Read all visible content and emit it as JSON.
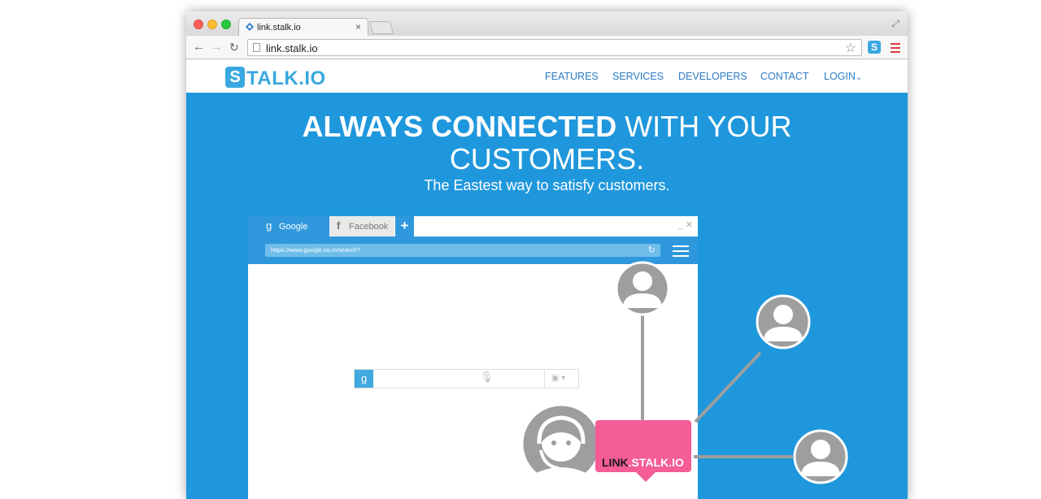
{
  "browser": {
    "tab_title": "link.stalk.io",
    "tab_close": "×",
    "url": "link.stalk.io",
    "extension_letter": "S"
  },
  "site": {
    "logo_letter": "S",
    "logo_text": "TALK.IO",
    "nav": [
      "FEATURES",
      "SERVICES",
      "DEVELOPERS",
      "CONTACT",
      "LOGIN"
    ],
    "login_caret": "⌄"
  },
  "hero": {
    "title_bold": "ALWAYS CONNECTED",
    "title_rest": " WITH YOUR",
    "title_line2": "CUSTOMERS.",
    "subtitle": "The Eastest way to satisfy customers."
  },
  "mockup": {
    "tabs": [
      {
        "icon": "g",
        "label": "Google"
      },
      {
        "icon": "f",
        "label": "Facebook"
      }
    ],
    "new_tab": "+",
    "window_controls": "_  ✕",
    "address": "https://www.google.co.in/search?",
    "search_icon_letter": "g"
  },
  "badge": {
    "prefix": "LINK",
    "suffix": ".STALK.IO"
  },
  "colors": {
    "hero_bg": "#1f97dc",
    "brand": "#3aa8e0",
    "nav_text": "#2b7cc4",
    "badge_pink": "#f45d96",
    "avatar_gray": "#9e9e9e"
  }
}
